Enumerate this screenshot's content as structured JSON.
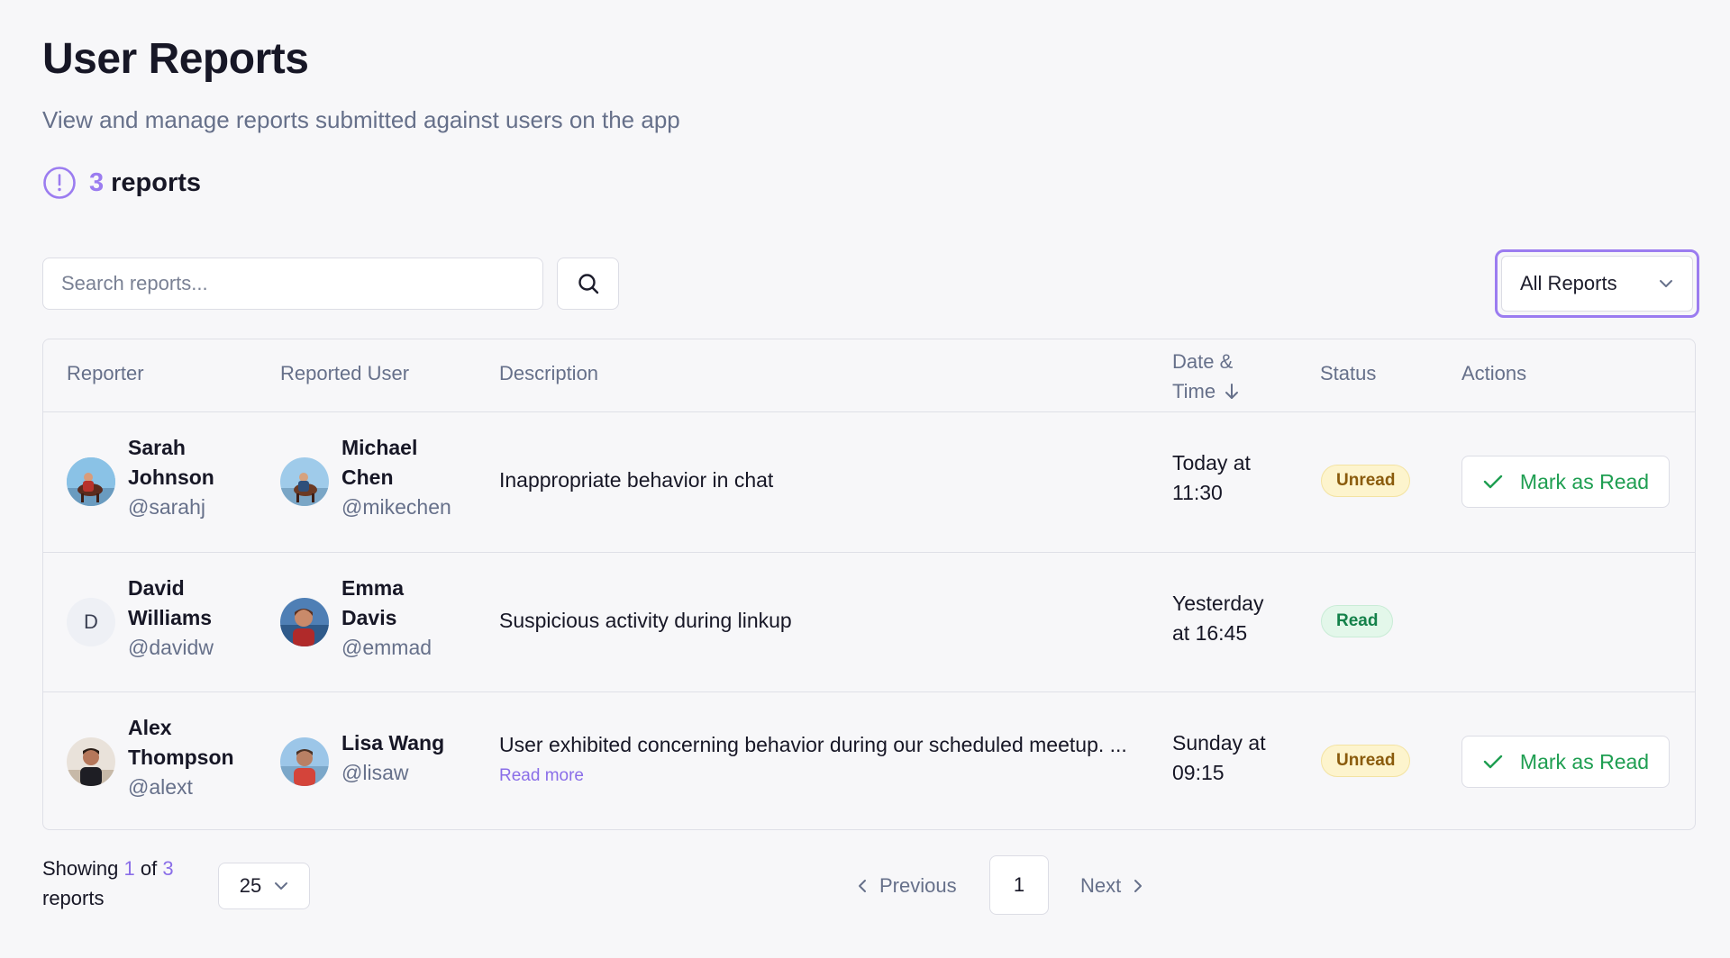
{
  "header": {
    "title": "User Reports",
    "subtitle": "View and manage reports submitted against users on the app",
    "count": "3",
    "count_label": "reports"
  },
  "search": {
    "placeholder": "Search reports..."
  },
  "filter": {
    "selected": "All Reports"
  },
  "table": {
    "columns": {
      "reporter": "Reporter",
      "reported_user": "Reported User",
      "description": "Description",
      "date_line1": "Date &",
      "date_line2": "Time",
      "status": "Status",
      "actions": "Actions"
    },
    "rows": [
      {
        "reporter": {
          "first": "Sarah",
          "last": "Johnson",
          "handle": "@sarahj",
          "avatar": "photo"
        },
        "reported": {
          "first": "Michael",
          "last": "Chen",
          "handle": "@mikechen",
          "avatar": "photo"
        },
        "description": "Inappropriate behavior in chat",
        "date_line1": "Today at",
        "date_line2": "11:30",
        "status": "Unread",
        "action": "Mark as Read"
      },
      {
        "reporter": {
          "first": "David",
          "last": "Williams",
          "handle": "@davidw",
          "avatar": "D"
        },
        "reported": {
          "first": "Emma",
          "last": "Davis",
          "handle": "@emmad",
          "avatar": "photo"
        },
        "description": "Suspicious activity during linkup",
        "date_line1": "Yesterday",
        "date_line2": "at 16:45",
        "status": "Read",
        "action": ""
      },
      {
        "reporter": {
          "first": "Alex",
          "last": "Thompson",
          "handle": "@alext",
          "avatar": "photo"
        },
        "reported": {
          "name": "Lisa Wang",
          "handle": "@lisaw",
          "avatar": "photo"
        },
        "description": "User exhibited concerning behavior during our scheduled meetup. ...",
        "read_more": "Read more",
        "date_line1": "Sunday at",
        "date_line2": "09:15",
        "status": "Unread",
        "action": "Mark as Read"
      }
    ]
  },
  "footer": {
    "showing_prefix": "Showing",
    "showing_from": "1",
    "showing_of": "of",
    "showing_total": "3",
    "showing_suffix": "reports",
    "per_page": "25",
    "previous": "Previous",
    "current_page": "1",
    "next": "Next"
  },
  "colors": {
    "accent": "#9b7cf0",
    "unread_bg": "#fdf4cd",
    "read_bg": "#e3f7ea",
    "mark_read": "#1e9e51"
  },
  "icons": [
    "alert-circle-icon",
    "search-icon",
    "chevron-down-icon",
    "arrow-down-icon",
    "check-icon",
    "chevron-left-icon",
    "chevron-right-icon"
  ]
}
